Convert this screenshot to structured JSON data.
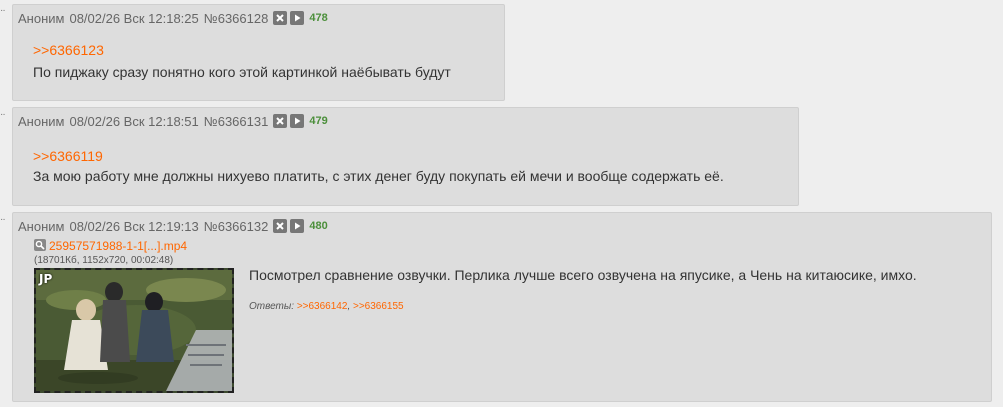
{
  "colors": {
    "background": "#eeeeee",
    "post_background": "#dddddd",
    "link": "#ff6600",
    "count": "#4c8f3b"
  },
  "posts": [
    {
      "name": "Аноним",
      "date": "08/02/26 Вск 12:18:25",
      "number": "№6366128",
      "count": "478",
      "reply_link": ">>6366123",
      "text": "По пиджаку сразу понятно кого этой картинкой наёбывать будут"
    },
    {
      "name": "Аноним",
      "date": "08/02/26 Вск 12:18:51",
      "number": "№6366131",
      "count": "479",
      "reply_link": ">>6366119",
      "text": "За мою работу мне должны нихуево платить, с этих денег буду покупать ей мечи и вообще содержать её."
    },
    {
      "name": "Аноним",
      "date": "08/02/26 Вск 12:19:13",
      "number": "№6366132",
      "count": "480",
      "file_name": "25957571988-1-1[...].mp4",
      "file_meta": "(18701Кб, 1152x720, 00:02:48)",
      "thumb_label": "JP",
      "text": "Посмотрел сравнение озвучки. Перлика лучше всего озвучена на япусике, а Чень на китаюсике, имхо.",
      "replies_label": "Ответы:",
      "replies": [
        ">>6366142",
        ">>6366155"
      ]
    }
  ]
}
